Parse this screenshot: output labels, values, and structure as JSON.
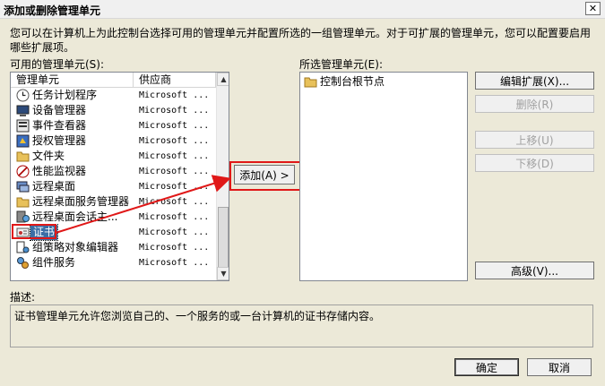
{
  "window": {
    "title": "添加或删除管理单元",
    "close_glyph": "✕"
  },
  "intro_text": "您可以在计算机上为此控制台选择可用的管理单元并配置所选的一组管理单元。对于可扩展的管理单元，您可以配置要启用哪些扩展项。",
  "available": {
    "label": "可用的管理单元(S):",
    "col_name": "管理单元",
    "col_vendor": "供应商",
    "items": [
      {
        "name": "任务计划程序",
        "vendor": "Microsoft ...",
        "icon": "clock-icon"
      },
      {
        "name": "设备管理器",
        "vendor": "Microsoft ...",
        "icon": "device-manager-icon"
      },
      {
        "name": "事件查看器",
        "vendor": "Microsoft ...",
        "icon": "event-viewer-icon"
      },
      {
        "name": "授权管理器",
        "vendor": "Microsoft ...",
        "icon": "authorization-icon"
      },
      {
        "name": "文件夹",
        "vendor": "Microsoft ...",
        "icon": "folder-icon"
      },
      {
        "name": "性能监视器",
        "vendor": "Microsoft ...",
        "icon": "performance-icon"
      },
      {
        "name": "远程桌面",
        "vendor": "Microsoft ...",
        "icon": "remote-desktop-icon"
      },
      {
        "name": "远程桌面服务管理器",
        "vendor": "Microsoft ...",
        "icon": "folder-icon"
      },
      {
        "name": "远程桌面会话主...",
        "vendor": "Microsoft ...",
        "icon": "session-host-icon"
      },
      {
        "name": "证书",
        "vendor": "Microsoft ...",
        "icon": "certificate-icon"
      },
      {
        "name": "组策略对象编辑器",
        "vendor": "Microsoft ...",
        "icon": "group-policy-icon"
      },
      {
        "name": "组件服务",
        "vendor": "Microsoft ...",
        "icon": "component-services-icon"
      }
    ],
    "selected_index": 9
  },
  "add_button": "添加(A) >",
  "selected": {
    "label": "所选管理单元(E):",
    "items": [
      {
        "name": "控制台根节点",
        "icon": "folder-icon"
      }
    ]
  },
  "buttons": {
    "edit_extensions": "编辑扩展(X)...",
    "remove": "删除(R)",
    "move_up": "上移(U)",
    "move_down": "下移(D)",
    "advanced": "高级(V)..."
  },
  "description": {
    "label": "描述:",
    "text": "证书管理单元允许您浏览自己的、一个服务的或一台计算机的证书存储内容。"
  },
  "footer": {
    "ok": "确定",
    "cancel": "取消"
  },
  "colors": {
    "selection": "#3b6ea5",
    "annotation": "#e01818"
  }
}
